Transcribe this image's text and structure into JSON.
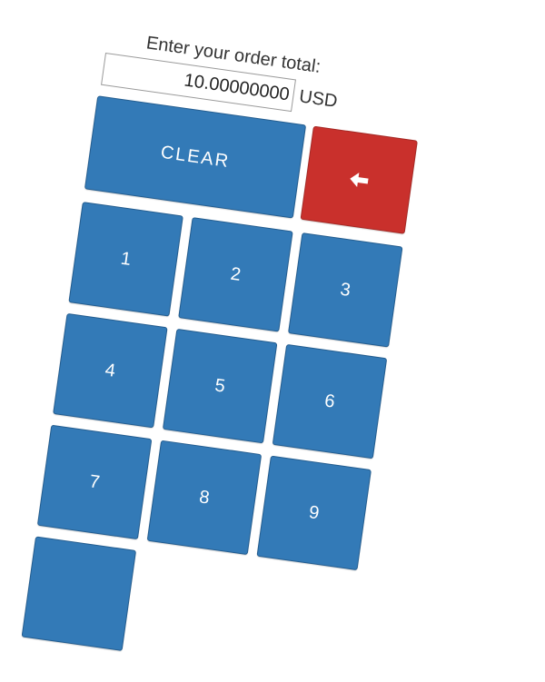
{
  "order": {
    "prompt": "Enter your order total:",
    "amount_value": "10.00000000",
    "currency": "USD"
  },
  "keypad": {
    "clear_label": "CLEAR",
    "backspace_icon": "backspace-arrow-icon",
    "keys": [
      "1",
      "2",
      "3",
      "4",
      "5",
      "6",
      "7",
      "8",
      "9"
    ]
  },
  "colors": {
    "key_blue": "#337ab7",
    "backspace_red": "#c9302c"
  }
}
